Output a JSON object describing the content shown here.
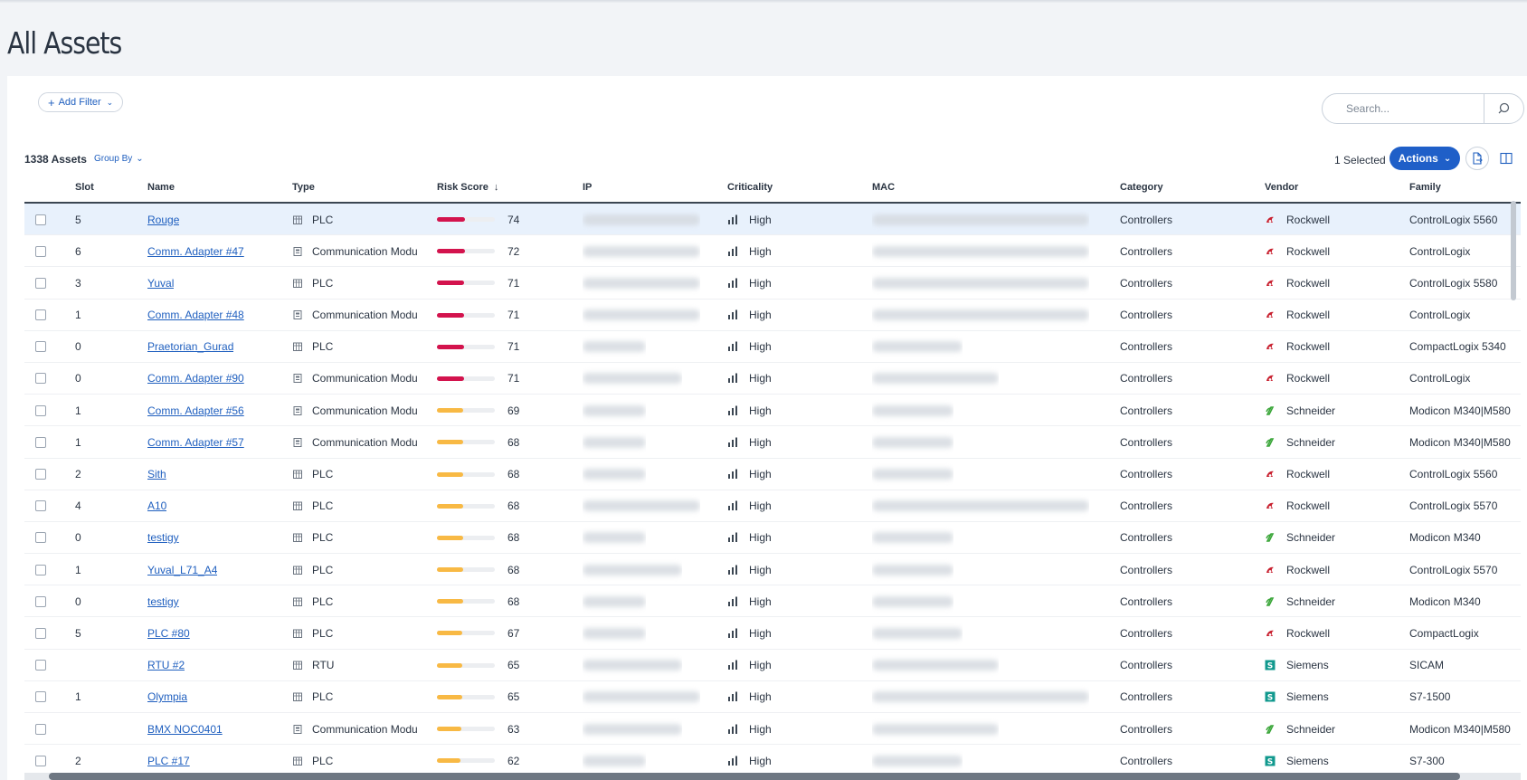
{
  "page": {
    "title": "All Assets"
  },
  "toolbar": {
    "add_filter": "Add Filter",
    "search_placeholder": "Search...",
    "asset_count": "1338 Assets",
    "group_by": "Group By",
    "selected_count": "1 Selected",
    "actions": "Actions"
  },
  "columns": {
    "slot": "Slot",
    "name": "Name",
    "type": "Type",
    "risk": "Risk Score",
    "ip": "IP",
    "criticality": "Criticality",
    "mac": "MAC",
    "category": "Category",
    "vendor": "Vendor",
    "family": "Family"
  },
  "risk_colors": {
    "high": "#d3134d",
    "medium": "#f8b944"
  },
  "vendor_colors": {
    "Rockwell": "#c8202f",
    "Schneider": "#3aa639",
    "Siemens": "#11998e"
  },
  "rows": [
    {
      "slot": "5",
      "name": "Rouge",
      "type": "PLC",
      "type_icon": "building-icon",
      "risk": 74,
      "criticality": "High",
      "category": "Controllers",
      "vendor": "Rockwell",
      "family": "ControlLogix 5560",
      "selected": true
    },
    {
      "slot": "6",
      "name": "Comm. Adapter #47",
      "type": "Communication Modu",
      "type_icon": "module-icon",
      "risk": 72,
      "criticality": "High",
      "category": "Controllers",
      "vendor": "Rockwell",
      "family": "ControlLogix"
    },
    {
      "slot": "3",
      "name": "Yuval",
      "type": "PLC",
      "type_icon": "building-icon",
      "risk": 71,
      "criticality": "High",
      "category": "Controllers",
      "vendor": "Rockwell",
      "family": "ControlLogix 5580"
    },
    {
      "slot": "1",
      "name": "Comm. Adapter #48",
      "type": "Communication Modu",
      "type_icon": "module-icon",
      "risk": 71,
      "criticality": "High",
      "category": "Controllers",
      "vendor": "Rockwell",
      "family": "ControlLogix"
    },
    {
      "slot": "0",
      "name": "Praetorian_Gurad",
      "type": "PLC",
      "type_icon": "building-icon",
      "risk": 71,
      "criticality": "High",
      "category": "Controllers",
      "vendor": "Rockwell",
      "family": "CompactLogix 5340"
    },
    {
      "slot": "0",
      "name": "Comm. Adapter #90",
      "type": "Communication Modu",
      "type_icon": "module-icon",
      "risk": 71,
      "criticality": "High",
      "category": "Controllers",
      "vendor": "Rockwell",
      "family": "ControlLogix"
    },
    {
      "slot": "1",
      "name": "Comm. Adapter #56",
      "type": "Communication Modu",
      "type_icon": "module-icon",
      "risk": 69,
      "criticality": "High",
      "category": "Controllers",
      "vendor": "Schneider",
      "family": "Modicon M340|M580"
    },
    {
      "slot": "1",
      "name": "Comm. Adapter #57",
      "type": "Communication Modu",
      "type_icon": "module-icon",
      "risk": 68,
      "criticality": "High",
      "category": "Controllers",
      "vendor": "Schneider",
      "family": "Modicon M340|M580"
    },
    {
      "slot": "2",
      "name": "Sith",
      "type": "PLC",
      "type_icon": "building-icon",
      "risk": 68,
      "criticality": "High",
      "category": "Controllers",
      "vendor": "Rockwell",
      "family": "ControlLogix 5560"
    },
    {
      "slot": "4",
      "name": "A10",
      "type": "PLC",
      "type_icon": "building-icon",
      "risk": 68,
      "criticality": "High",
      "category": "Controllers",
      "vendor": "Rockwell",
      "family": "ControlLogix 5570"
    },
    {
      "slot": "0",
      "name": "testigy",
      "type": "PLC",
      "type_icon": "building-icon",
      "risk": 68,
      "criticality": "High",
      "category": "Controllers",
      "vendor": "Schneider",
      "family": "Modicon M340"
    },
    {
      "slot": "1",
      "name": "Yuval_L71_A4",
      "type": "PLC",
      "type_icon": "building-icon",
      "risk": 68,
      "criticality": "High",
      "category": "Controllers",
      "vendor": "Rockwell",
      "family": "ControlLogix 5570"
    },
    {
      "slot": "0",
      "name": "testigy",
      "type": "PLC",
      "type_icon": "building-icon",
      "risk": 68,
      "criticality": "High",
      "category": "Controllers",
      "vendor": "Schneider",
      "family": "Modicon M340"
    },
    {
      "slot": "5",
      "name": "PLC #80",
      "type": "PLC",
      "type_icon": "building-icon",
      "risk": 67,
      "criticality": "High",
      "category": "Controllers",
      "vendor": "Rockwell",
      "family": "CompactLogix"
    },
    {
      "slot": "",
      "name": "RTU #2",
      "type": "RTU",
      "type_icon": "building-icon",
      "risk": 65,
      "criticality": "High",
      "category": "Controllers",
      "vendor": "Siemens",
      "family": "SICAM"
    },
    {
      "slot": "1",
      "name": "Olympia",
      "type": "PLC",
      "type_icon": "building-icon",
      "risk": 65,
      "criticality": "High",
      "category": "Controllers",
      "vendor": "Siemens",
      "family": "S7-1500"
    },
    {
      "slot": "",
      "name": "BMX NOC0401",
      "type": "Communication Modu",
      "type_icon": "module-icon",
      "risk": 63,
      "criticality": "High",
      "category": "Controllers",
      "vendor": "Schneider",
      "family": "Modicon M340|M580"
    },
    {
      "slot": "2",
      "name": "PLC #17",
      "type": "PLC",
      "type_icon": "building-icon",
      "risk": 62,
      "criticality": "High",
      "category": "Controllers",
      "vendor": "Siemens",
      "family": "S7-300"
    }
  ]
}
